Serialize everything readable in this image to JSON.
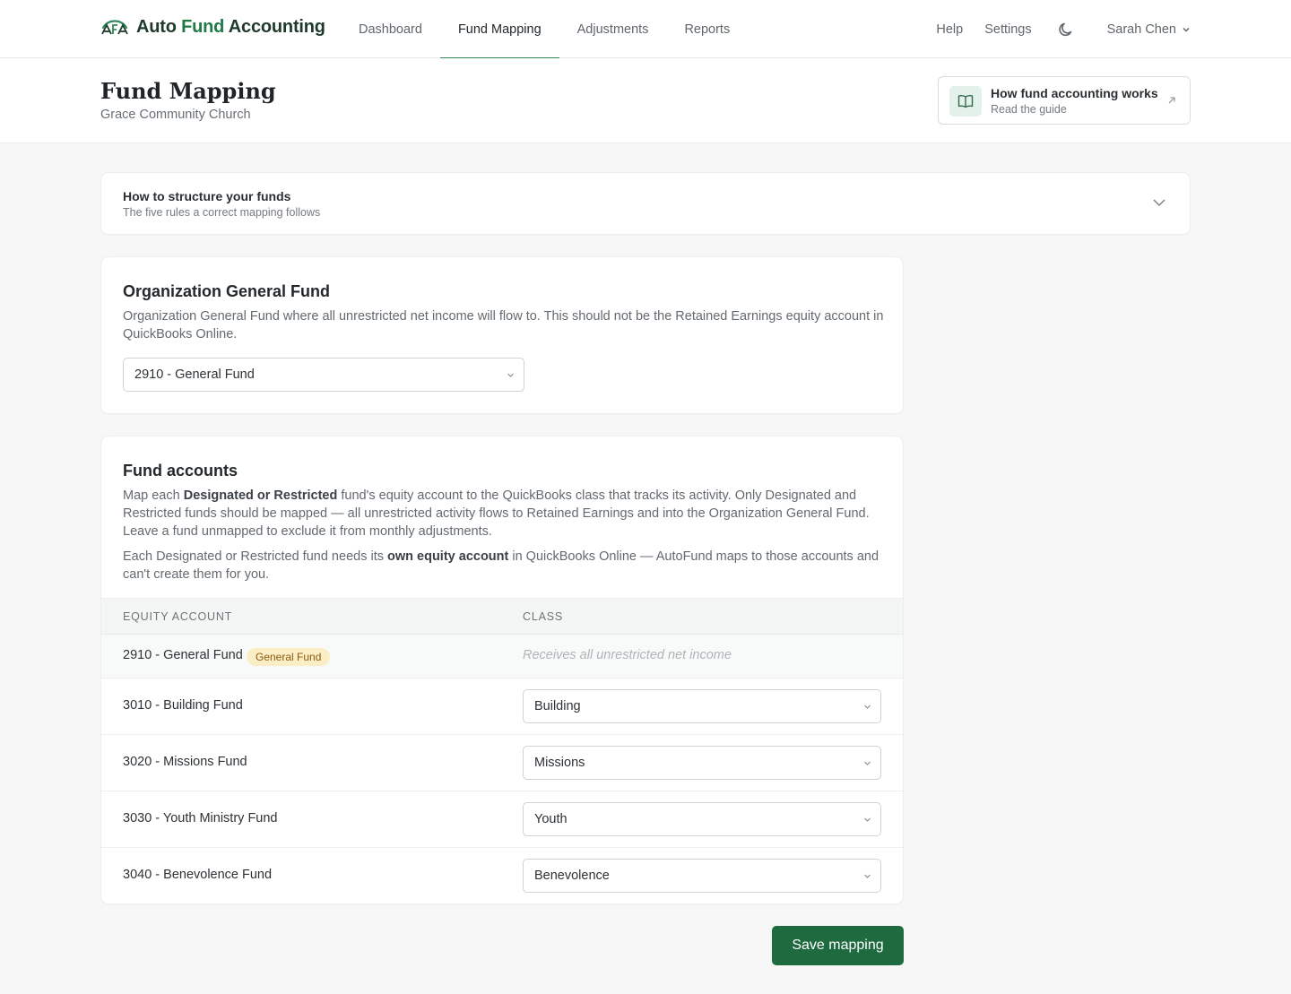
{
  "app": {
    "logo_prefix": "Auto ",
    "logo_accent": "Fund",
    "logo_suffix": " Accounting"
  },
  "nav": {
    "items": [
      {
        "label": "Dashboard"
      },
      {
        "label": "Fund Mapping",
        "active": true
      },
      {
        "label": "Adjustments"
      },
      {
        "label": "Reports"
      }
    ],
    "help": "Help",
    "settings": "Settings",
    "theme_icon": "moon-icon",
    "user_name": "Sarah Chen"
  },
  "page": {
    "title": "Fund Mapping",
    "subtitle": "Grace Community Church"
  },
  "guide": {
    "title": "How fund accounting works",
    "subtitle": "Read the guide",
    "icon": "book-open-icon",
    "arrow_icon": "external-arrow-icon"
  },
  "rules": {
    "title": "How to structure your funds",
    "subtitle": "The five rules a correct mapping follows"
  },
  "general_fund": {
    "heading": "Organization General Fund",
    "description": "Organization General Fund where all unrestricted net income will flow to. This should not be the Retained Earnings equity account in QuickBooks Online.",
    "selected": "2910 - General Fund"
  },
  "fund_accounts": {
    "heading": "Fund accounts",
    "p1_a": "Map each ",
    "p1_b": "Designated or Restricted",
    "p1_c": " fund's equity account to the QuickBooks class that tracks its activity. Only Designated and Restricted funds should be mapped — all unrestricted activity flows to Retained Earnings and into the Organization General Fund. Leave a fund unmapped to exclude it from monthly adjustments.",
    "p2_a": "Each Designated or Restricted fund needs its ",
    "p2_b": "own equity account",
    "p2_c": " in QuickBooks Online — AutoFund maps to those accounts and can't create them for you.",
    "columns": {
      "account": "EQUITY ACCOUNT",
      "class": "CLASS"
    },
    "general_row": {
      "account": "2910 - General Fund",
      "badge": "General Fund",
      "note": "Receives all unrestricted net income"
    },
    "rows": [
      {
        "account": "3010 - Building Fund",
        "class": "Building"
      },
      {
        "account": "3020 - Missions Fund",
        "class": "Missions"
      },
      {
        "account": "3030 - Youth Ministry Fund",
        "class": "Youth"
      },
      {
        "account": "3040 - Benevolence Fund",
        "class": "Benevolence"
      }
    ]
  },
  "actions": {
    "save": "Save mapping"
  },
  "colors": {
    "brand": "#1e6b40",
    "accent": "#2f8a5a",
    "badge_bg": "#fbeec4",
    "badge_text": "#8a5a10"
  }
}
